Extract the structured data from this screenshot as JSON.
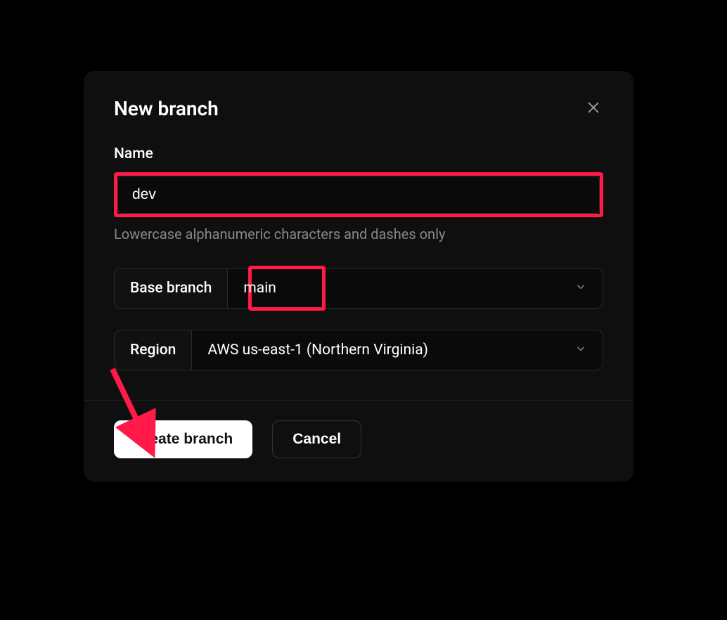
{
  "modal": {
    "title": "New branch",
    "name": {
      "label": "Name",
      "value": "dev",
      "helper": "Lowercase alphanumeric characters and dashes only"
    },
    "base_branch": {
      "label": "Base branch",
      "value": "main"
    },
    "region": {
      "label": "Region",
      "value": "AWS us-east-1 (Northern Virginia)"
    },
    "buttons": {
      "create": "Create branch",
      "cancel": "Cancel"
    }
  },
  "annotations": {
    "highlight_color": "#ff1a4a"
  }
}
